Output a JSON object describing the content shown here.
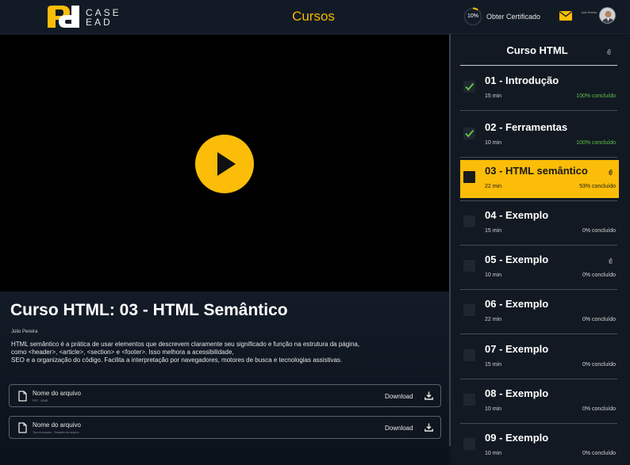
{
  "header": {
    "logo_text": "CASE EAD",
    "title": "Cursos",
    "progress": "10%",
    "progress_fraction": 0.1,
    "certificate_label": "Obter Certificado",
    "user_name": "Júlio Pereira",
    "accent_color": "#fbbd08"
  },
  "video": {
    "play_icon": "play-icon"
  },
  "lesson": {
    "title": "Curso HTML: 03 - HTML Semântico",
    "author": "Júlio Pereira",
    "description": " HTML semântico é a prática de usar elementos que descrevem claramente seu significado e função na estrutura da página, como <header>, <article>, <section> e <footer>. Isso melhora a acessibilidade,\nSEO e a organização do código. Facilita a interpretação por navegadores, motores de busca e tecnologias assistivas."
  },
  "files": [
    {
      "name": "Nome do arquivo",
      "meta": "PDF - 40MB",
      "download_label": "Download"
    },
    {
      "name": "Nome do arquivo",
      "meta": "Tipo do arquivo - Tamanho do arquivo",
      "download_label": "Download"
    }
  ],
  "sidebar": {
    "title": "Curso HTML",
    "lessons": [
      {
        "name": "01 - Introdução",
        "duration": "15 min",
        "progress": "100% concluído",
        "completed": true,
        "active": false,
        "attachment": false
      },
      {
        "name": "02 - Ferramentas",
        "duration": "10 min",
        "progress": "100% concluído",
        "completed": true,
        "active": false,
        "attachment": false
      },
      {
        "name": "03 - HTML semântico",
        "duration": "22 min",
        "progress": "53% concluído",
        "completed": false,
        "active": true,
        "attachment": true
      },
      {
        "name": "04 - Exemplo",
        "duration": "15 min",
        "progress": "0% concluído",
        "completed": false,
        "active": false,
        "attachment": false
      },
      {
        "name": "05 - Exemplo",
        "duration": "10 min",
        "progress": "0% concluído",
        "completed": false,
        "active": false,
        "attachment": true
      },
      {
        "name": "06 - Exemplo",
        "duration": "22 min",
        "progress": "0% concluído",
        "completed": false,
        "active": false,
        "attachment": false
      },
      {
        "name": "07 - Exemplo",
        "duration": "15 min",
        "progress": "0% concluído",
        "completed": false,
        "active": false,
        "attachment": false
      },
      {
        "name": "08 - Exemplo",
        "duration": "10 min",
        "progress": "0% concluído",
        "completed": false,
        "active": false,
        "attachment": false
      },
      {
        "name": "09 - Exemplo",
        "duration": "10 min",
        "progress": "0% concluído",
        "completed": false,
        "active": false,
        "attachment": false
      }
    ]
  }
}
